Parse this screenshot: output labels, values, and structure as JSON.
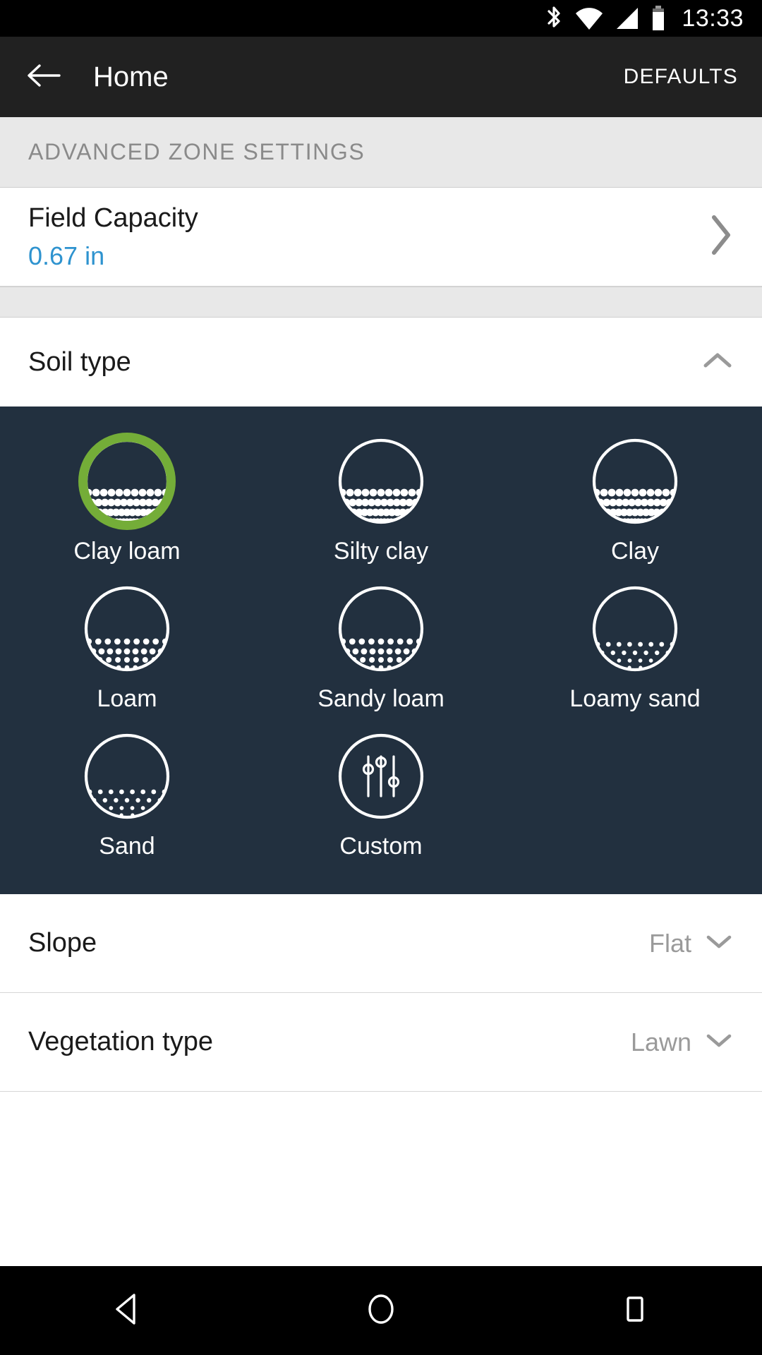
{
  "status_bar": {
    "time": "13:33",
    "icons": [
      "bluetooth-icon",
      "wifi-icon",
      "cell-signal-icon",
      "battery-icon"
    ]
  },
  "app_bar": {
    "back_icon": "arrow-left-icon",
    "title": "Home",
    "action_label": "DEFAULTS"
  },
  "section": {
    "header": "ADVANCED ZONE SETTINGS"
  },
  "field_capacity": {
    "label": "Field Capacity",
    "value": "0.67 in",
    "value_color": "#2e93cf",
    "chevron_icon": "chevron-right-icon"
  },
  "soil_type": {
    "label": "Soil type",
    "expanded": true,
    "collapse_icon": "chevron-up-icon",
    "selected": "Clay loam",
    "selection_color": "#74ad38",
    "panel_color": "#22303f",
    "options": [
      {
        "label": "Clay loam",
        "density": "dense",
        "selected": true
      },
      {
        "label": "Silty clay",
        "density": "dense",
        "selected": false
      },
      {
        "label": "Clay",
        "density": "dense",
        "selected": false
      },
      {
        "label": "Loam",
        "density": "medium",
        "selected": false
      },
      {
        "label": "Sandy loam",
        "density": "medium",
        "selected": false
      },
      {
        "label": "Loamy sand",
        "density": "sparse",
        "selected": false
      },
      {
        "label": "Sand",
        "density": "sparse",
        "selected": false
      },
      {
        "label": "Custom",
        "density": "sliders",
        "selected": false
      }
    ]
  },
  "slope": {
    "label": "Slope",
    "value": "Flat",
    "chevron_icon": "chevron-down-icon"
  },
  "vegetation": {
    "label": "Vegetation type",
    "value": "Lawn",
    "chevron_icon": "chevron-down-icon"
  },
  "nav_bar": {
    "back": "triangle-back-icon",
    "home": "circle-home-icon",
    "recents": "square-recents-icon"
  }
}
